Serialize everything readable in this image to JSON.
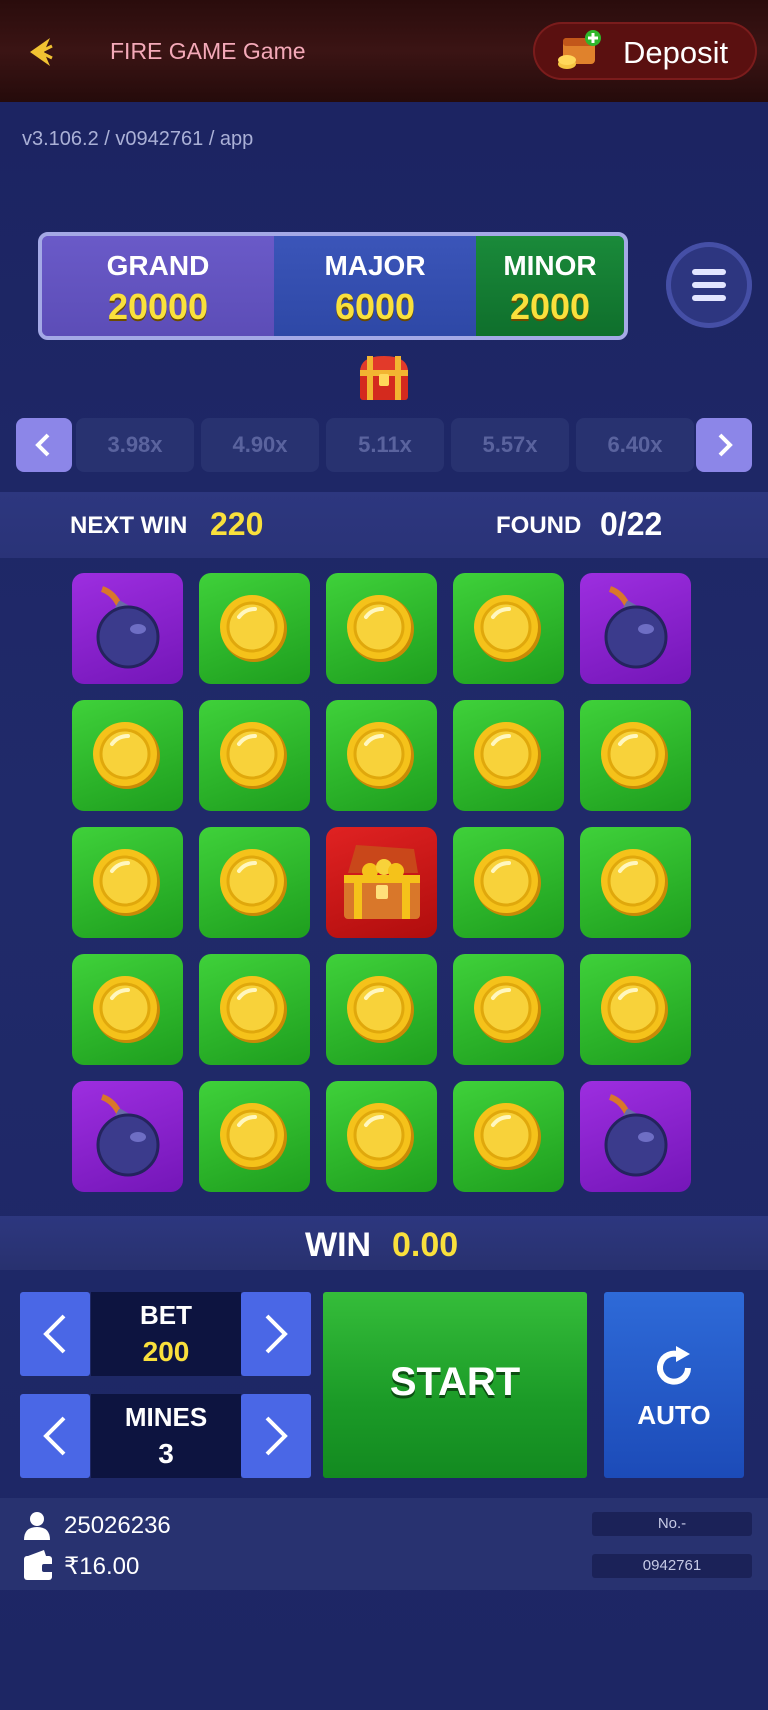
{
  "header": {
    "title": "FIRE GAME Game",
    "deposit_label": "Deposit"
  },
  "version": "v3.106.2 / v0942761 / app",
  "jackpots": [
    {
      "label": "GRAND",
      "value": "20000"
    },
    {
      "label": "MAJOR",
      "value": "6000"
    },
    {
      "label": "MINOR",
      "value": "2000"
    }
  ],
  "multipliers": [
    "3.98x",
    "4.90x",
    "5.11x",
    "5.57x",
    "6.40x"
  ],
  "status": {
    "next_win_label": "NEXT WIN",
    "next_win_value": "220",
    "found_label": "FOUND",
    "found_value": "0/22"
  },
  "grid": [
    [
      "bomb",
      "coin",
      "coin",
      "coin",
      "bomb"
    ],
    [
      "coin",
      "coin",
      "coin",
      "coin",
      "coin"
    ],
    [
      "coin",
      "coin",
      "chest",
      "coin",
      "coin"
    ],
    [
      "coin",
      "coin",
      "coin",
      "coin",
      "coin"
    ],
    [
      "bomb",
      "coin",
      "coin",
      "coin",
      "bomb"
    ]
  ],
  "win": {
    "label": "WIN",
    "value": "0.00"
  },
  "controls": {
    "bet_label": "BET",
    "bet_value": "200",
    "mines_label": "MINES",
    "mines_value": "3",
    "start_label": "START",
    "auto_label": "AUTO"
  },
  "footer": {
    "user_id": "25026236",
    "balance": "₹16.00",
    "no_label": "No.-",
    "round_id": "0942761"
  },
  "colors": {
    "accent_yellow": "#f9e03c",
    "coin_tile": "#2fb82c",
    "bomb_tile": "#8a22d0",
    "chest_tile": "#d01818",
    "start_green": "#1b9a27",
    "auto_blue": "#2458c8"
  }
}
